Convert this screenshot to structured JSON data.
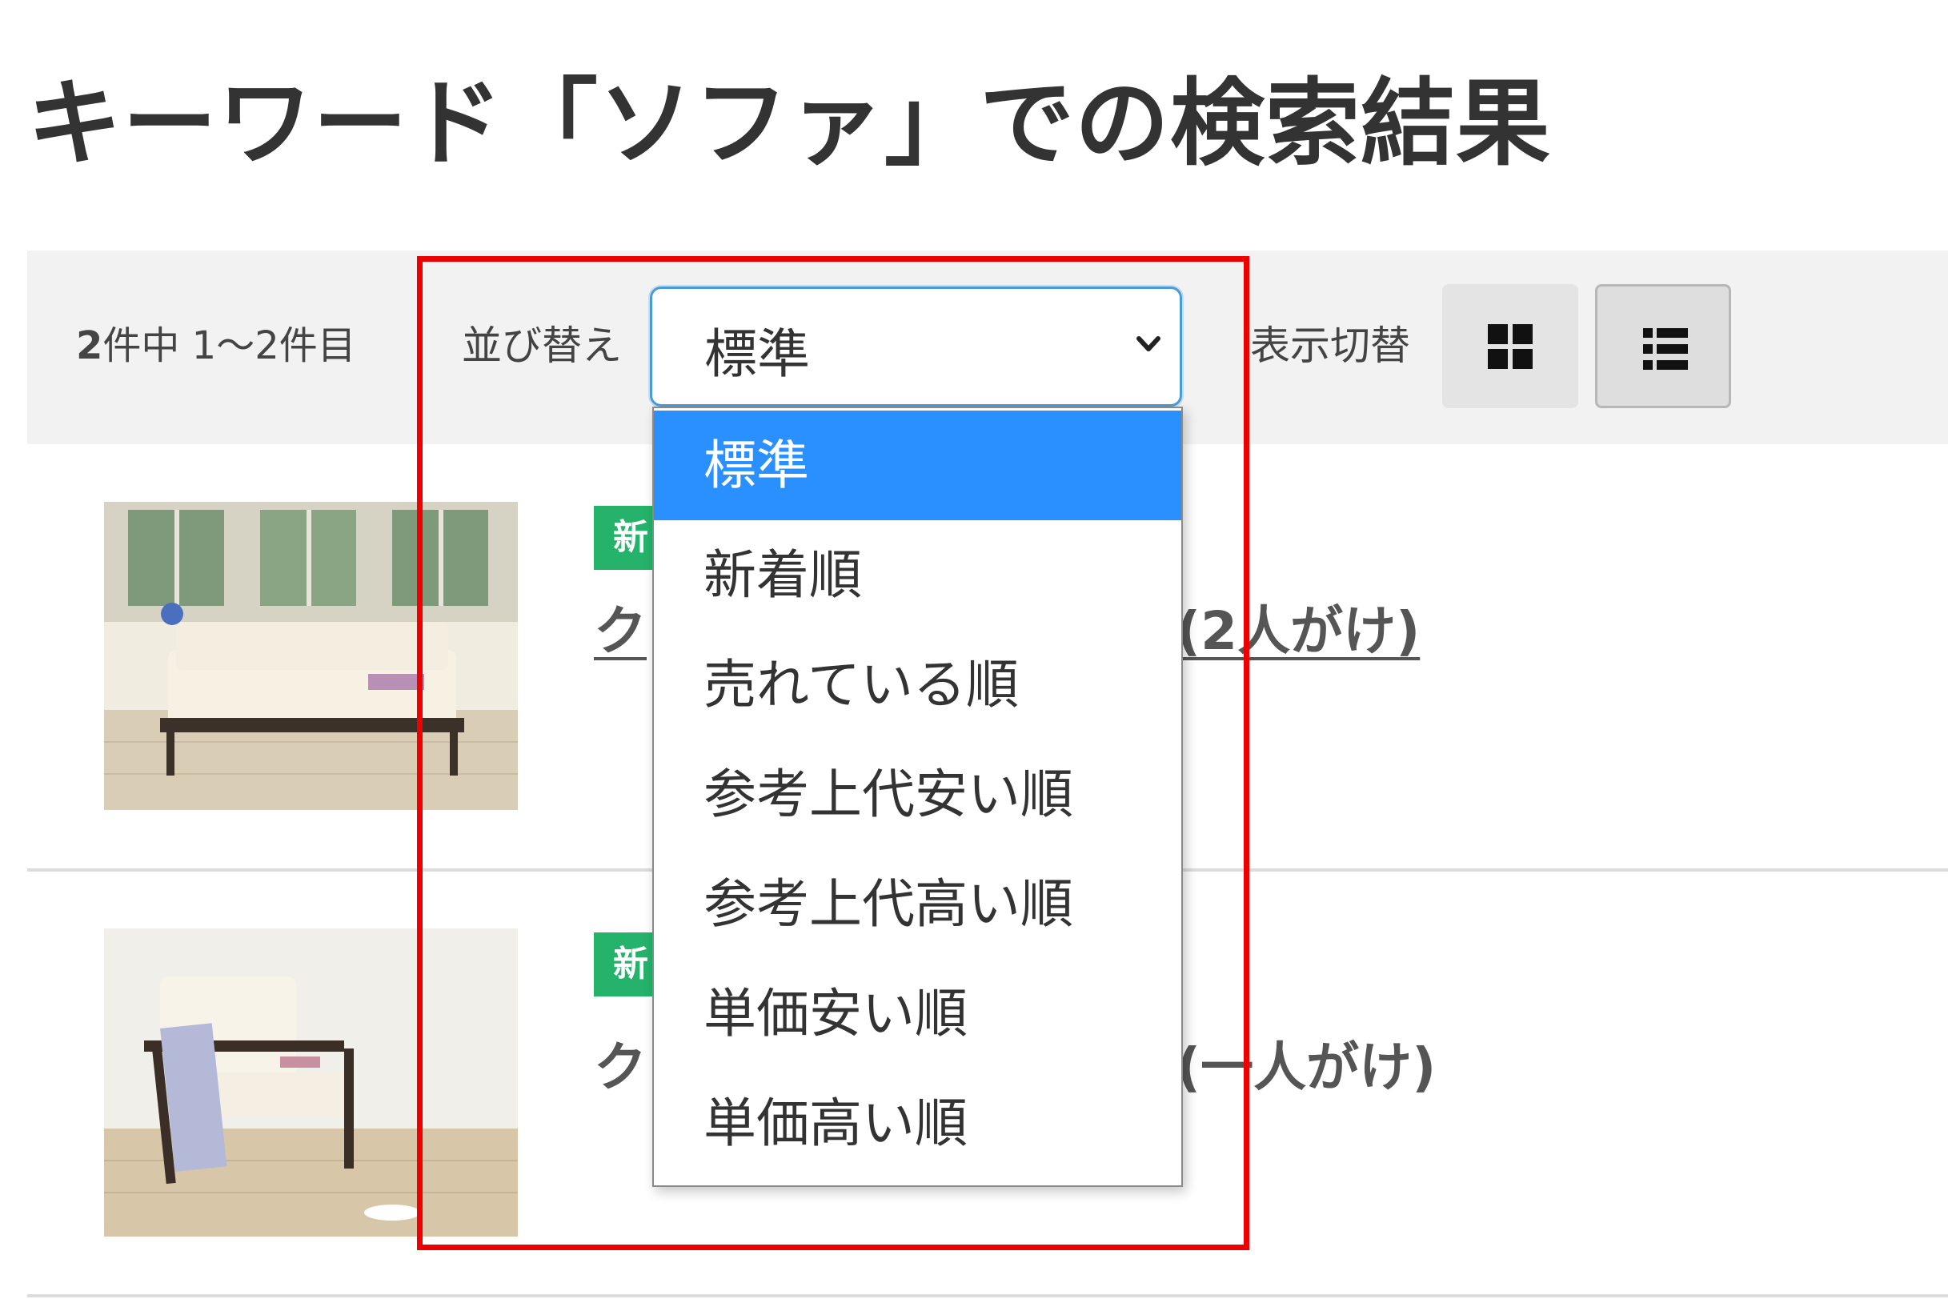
{
  "page_title": "キーワード「ソファ」での検索結果",
  "toolbar": {
    "result_count_number": "2",
    "result_count_text": "件中 1～2件目",
    "sort_label": "並び替え",
    "sort_selected": "標準",
    "view_label": "表示切替",
    "view_options": [
      "grid-view-icon",
      "list-view-icon"
    ],
    "active_view": "list"
  },
  "sort_options": [
    "標準",
    "新着順",
    "売れている順",
    "参考上代安い順",
    "参考上代高い順",
    "単価安い順",
    "単価高い順"
  ],
  "products": [
    {
      "badge": "新",
      "title_start": "ク",
      "title_end": "(2人がけ)",
      "linked": true
    },
    {
      "badge": "新",
      "title_start": "ク",
      "title_end": "(一人がけ)",
      "linked": false
    }
  ],
  "colors": {
    "select_focus": "#4a9bdc",
    "option_selected_bg": "#2b90ff",
    "new_badge": "#25b36b",
    "annotation_box": "#ee0000",
    "toolbar_bg": "#f2f2f2"
  }
}
